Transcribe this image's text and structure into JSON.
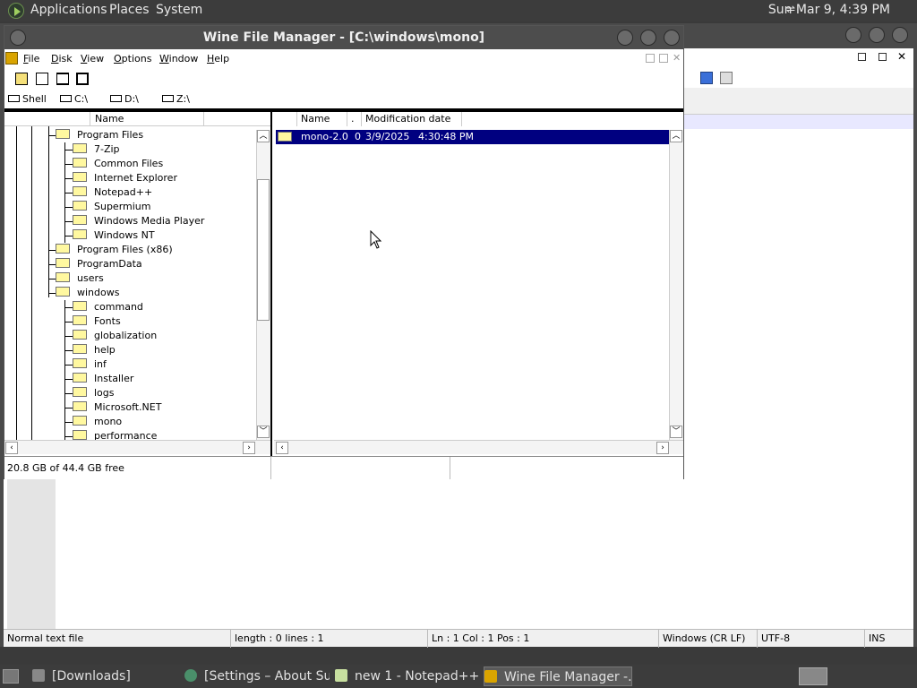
{
  "top_panel": {
    "menus": [
      "Applications",
      "Places",
      "System"
    ],
    "clock": "Sun Mar 9,  4:39 PM"
  },
  "notepad": {
    "status": {
      "type": "Normal text file",
      "length": "length : 0    lines : 1",
      "position": "Ln : 1    Col : 1    Pos : 1",
      "eol": "Windows (CR LF)",
      "encoding": "UTF-8",
      "mode": "INS"
    }
  },
  "wfm": {
    "title": "Wine File Manager - [C:\\windows\\mono]",
    "menus": [
      "File",
      "Disk",
      "View",
      "Options",
      "Window",
      "Help"
    ],
    "drives": [
      "Shell",
      "C:\\",
      "D:\\",
      "Z:\\"
    ],
    "tree_header": "Name",
    "tree_items": [
      "Program Files",
      "7-Zip",
      "Common Files",
      "Internet Explorer",
      "Notepad++",
      "Supermium",
      "Windows Media Player",
      "Windows NT",
      "Program Files (x86)",
      "ProgramData",
      "users",
      "windows",
      "command",
      "Fonts",
      "globalization",
      "help",
      "inf",
      "Installer",
      "logs",
      "Microsoft.NET",
      "mono",
      "performance"
    ],
    "list_headers": {
      "name": "Name",
      "dot": ".",
      "date": "Modification date"
    },
    "files": [
      {
        "name": "mono-2.0",
        "size": "0",
        "date": "3/9/2025",
        "time": "4:30:48 PM"
      }
    ],
    "status_free": "20.8 GB of 44.4 GB free"
  },
  "taskbar": {
    "tasks": [
      "[Downloads]",
      "[Settings – About Su...",
      "new 1 - Notepad++ ...",
      "Wine File Manager -..."
    ]
  }
}
